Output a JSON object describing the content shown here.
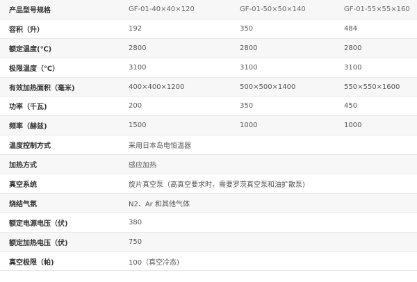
{
  "header": {
    "label": "产品型号规格",
    "models": [
      "GF-01-40×40×120",
      "GF-01-50×50×140",
      "GF-01-55×55×160"
    ]
  },
  "rows": [
    {
      "label": "容积（升）",
      "values": [
        "192",
        "350",
        "484"
      ]
    },
    {
      "label": "额定温度(℃)",
      "values": [
        "2800",
        "2800",
        "2800"
      ]
    },
    {
      "label": "极限温度（℃）",
      "values": [
        "3100",
        "3100",
        "3100"
      ]
    },
    {
      "label": "有效加热面积（毫米)",
      "values": [
        "400×400×1200",
        "500×500×1400",
        "550×550×1600"
      ]
    },
    {
      "label": "功率（千瓦)",
      "values": [
        "200",
        "350",
        "450"
      ]
    },
    {
      "label": "频率（赫兹)",
      "values": [
        "1500",
        "1000",
        "1000"
      ]
    },
    {
      "label": "温度控制方式",
      "span": "采用日本岛电恒温器"
    },
    {
      "label": "加热方式",
      "span": "感应加热"
    },
    {
      "label": "真空系统",
      "span": "旋片真空泵（高真空要求时，需要罗茨真空泵和油扩散泵)"
    },
    {
      "label": "烧结气氛",
      "span": "N2、Ar 和其他气体"
    },
    {
      "label": "额定电源电压（伏)",
      "span": "380"
    },
    {
      "label": "额定加热电压（伏)",
      "span": "750"
    },
    {
      "label": "真空极限（帕)",
      "span": "100（真空冷态)"
    }
  ]
}
